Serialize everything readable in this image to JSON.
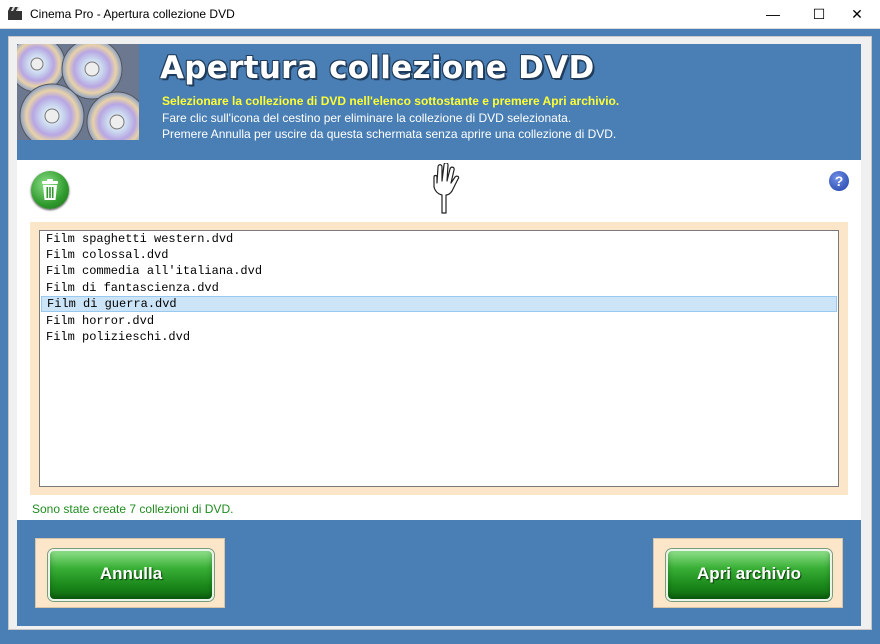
{
  "window": {
    "title": "Cinema Pro - Apertura collezione DVD",
    "controls": {
      "minimize": "—",
      "maximize": "☐",
      "close": "✕"
    }
  },
  "header": {
    "title": "Apertura collezione DVD",
    "line1": "Selezionare la collezione di DVD nell'elenco sottostante e premere Apri archivio.",
    "line2": "Fare clic sull'icona del cestino per eliminare la collezione di DVD selezionata.",
    "line3": "Premere Annulla per uscire da questa schermata senza aprire una collezione di DVD."
  },
  "toolbar": {
    "help_label": "?"
  },
  "collections": {
    "items": [
      {
        "label": "Film spaghetti western.dvd",
        "selected": false
      },
      {
        "label": "Film colossal.dvd",
        "selected": false
      },
      {
        "label": "Film commedia all'italiana.dvd",
        "selected": false
      },
      {
        "label": "Film di fantascienza.dvd",
        "selected": false
      },
      {
        "label": "Film di guerra.dvd",
        "selected": true
      },
      {
        "label": "Film horror.dvd",
        "selected": false
      },
      {
        "label": "Film polizieschi.dvd",
        "selected": false
      }
    ]
  },
  "status": {
    "text": "Sono state create 7 collezioni di DVD."
  },
  "buttons": {
    "cancel_label": "Annulla",
    "open_label": "Apri archivio"
  },
  "colors": {
    "accent": "#4a7fb5",
    "highlight_text": "#ffff33",
    "button_green": "#2f9a2c",
    "status_green": "#1f8c1f",
    "panel_beige": "#fbe6c9"
  },
  "icons": {
    "trash": "trash-icon",
    "pointer": "pointing-hand-icon",
    "help": "help-icon",
    "app": "clapperboard-icon"
  }
}
